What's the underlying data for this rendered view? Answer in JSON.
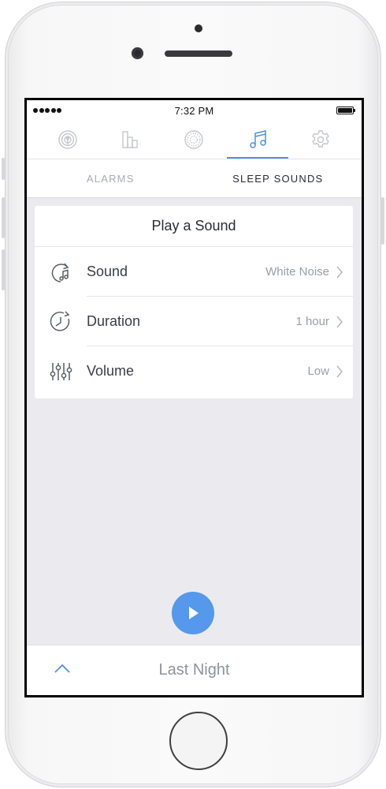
{
  "status_bar": {
    "time": "7:32 PM"
  },
  "icon_tabs": [
    {
      "icon": "broadcast-icon",
      "active": false
    },
    {
      "icon": "bar-chart-icon",
      "active": false
    },
    {
      "icon": "globe-icon",
      "active": false
    },
    {
      "icon": "music-note-icon",
      "active": true
    },
    {
      "icon": "gear-icon",
      "active": false
    }
  ],
  "sub_tabs": [
    {
      "label": "ALARMS",
      "active": false
    },
    {
      "label": "SLEEP SOUNDS",
      "active": true
    }
  ],
  "card": {
    "title": "Play a Sound",
    "rows": [
      {
        "icon": "sound-icon",
        "label": "Sound",
        "value": "White Noise"
      },
      {
        "icon": "duration-clock-icon",
        "label": "Duration",
        "value": "1 hour"
      },
      {
        "icon": "volume-sliders-icon",
        "label": "Volume",
        "value": "Low"
      }
    ]
  },
  "bottom_bar": {
    "label": "Last Night"
  },
  "colors": {
    "accent": "#4b92e6",
    "play_button": "#5598ec"
  }
}
